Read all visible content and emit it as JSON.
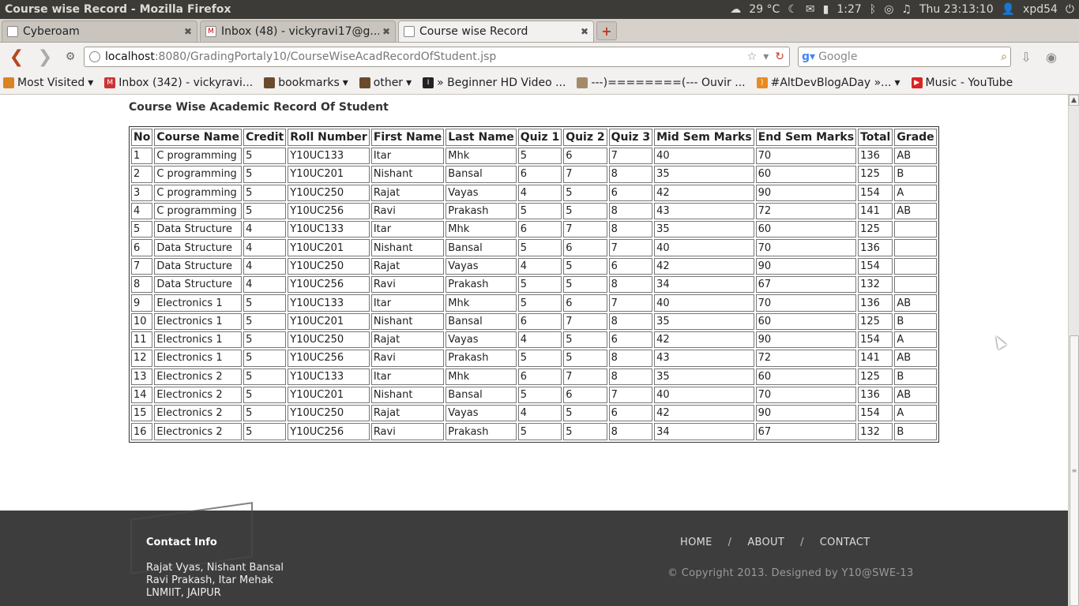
{
  "os": {
    "window_title": "Course wise Record - Mozilla Firefox",
    "temperature": "29 °C",
    "time_small": "1:27",
    "clock": "Thu 23:13:10",
    "user": "xpd54"
  },
  "tabs": [
    {
      "label": "Cyberoam"
    },
    {
      "label": "Inbox (48) - vickyravi17@g..."
    },
    {
      "label": "Course wise Record"
    }
  ],
  "nav": {
    "url_host": "localhost",
    "url_path": ":8080/GradingPortaly10/CourseWiseAcadRecordOfStudent.jsp",
    "search_placeholder": "Google"
  },
  "bookmarks": [
    {
      "label": "Most Visited"
    },
    {
      "label": "Inbox (342) - vickyravi..."
    },
    {
      "label": "bookmarks"
    },
    {
      "label": "other"
    },
    {
      "label": "» Beginner HD Video ..."
    },
    {
      "label": "---)========(--- Ouvir ..."
    },
    {
      "label": "#AltDevBlogADay »..."
    },
    {
      "label": "Music - YouTube"
    }
  ],
  "page": {
    "heading": "Course Wise Academic Record Of Student",
    "columns": [
      "No",
      "Course Name",
      "Credit",
      "Roll Number",
      "First Name",
      "Last Name",
      "Quiz 1",
      "Quiz 2",
      "Quiz 3",
      "Mid Sem Marks",
      "End Sem Marks",
      "Total",
      "Grade"
    ],
    "rows": [
      [
        "1",
        "C programming",
        "5",
        "Y10UC133",
        "Itar",
        "Mhk",
        "5",
        "6",
        "7",
        "40",
        "70",
        "136",
        "AB"
      ],
      [
        "2",
        "C programming",
        "5",
        "Y10UC201",
        "Nishant",
        "Bansal",
        "6",
        "7",
        "8",
        "35",
        "60",
        "125",
        "B"
      ],
      [
        "3",
        "C programming",
        "5",
        "Y10UC250",
        "Rajat",
        "Vayas",
        "4",
        "5",
        "6",
        "42",
        "90",
        "154",
        "A"
      ],
      [
        "4",
        "C programming",
        "5",
        "Y10UC256",
        "Ravi",
        "Prakash",
        "5",
        "5",
        "8",
        "43",
        "72",
        "141",
        "AB"
      ],
      [
        "5",
        "Data Structure",
        "4",
        "Y10UC133",
        "Itar",
        "Mhk",
        "6",
        "7",
        "8",
        "35",
        "60",
        "125",
        ""
      ],
      [
        "6",
        "Data Structure",
        "4",
        "Y10UC201",
        "Nishant",
        "Bansal",
        "5",
        "6",
        "7",
        "40",
        "70",
        "136",
        ""
      ],
      [
        "7",
        "Data Structure",
        "4",
        "Y10UC250",
        "Rajat",
        "Vayas",
        "4",
        "5",
        "6",
        "42",
        "90",
        "154",
        ""
      ],
      [
        "8",
        "Data Structure",
        "4",
        "Y10UC256",
        "Ravi",
        "Prakash",
        "5",
        "5",
        "8",
        "34",
        "67",
        "132",
        ""
      ],
      [
        "9",
        "Electronics 1",
        "5",
        "Y10UC133",
        "Itar",
        "Mhk",
        "5",
        "6",
        "7",
        "40",
        "70",
        "136",
        "AB"
      ],
      [
        "10",
        "Electronics 1",
        "5",
        "Y10UC201",
        "Nishant",
        "Bansal",
        "6",
        "7",
        "8",
        "35",
        "60",
        "125",
        "B"
      ],
      [
        "11",
        "Electronics 1",
        "5",
        "Y10UC250",
        "Rajat",
        "Vayas",
        "4",
        "5",
        "6",
        "42",
        "90",
        "154",
        "A"
      ],
      [
        "12",
        "Electronics 1",
        "5",
        "Y10UC256",
        "Ravi",
        "Prakash",
        "5",
        "5",
        "8",
        "43",
        "72",
        "141",
        "AB"
      ],
      [
        "13",
        "Electronics 2",
        "5",
        "Y10UC133",
        "Itar",
        "Mhk",
        "6",
        "7",
        "8",
        "35",
        "60",
        "125",
        "B"
      ],
      [
        "14",
        "Electronics 2",
        "5",
        "Y10UC201",
        "Nishant",
        "Bansal",
        "5",
        "6",
        "7",
        "40",
        "70",
        "136",
        "AB"
      ],
      [
        "15",
        "Electronics 2",
        "5",
        "Y10UC250",
        "Rajat",
        "Vayas",
        "4",
        "5",
        "6",
        "42",
        "90",
        "154",
        "A"
      ],
      [
        "16",
        "Electronics 2",
        "5",
        "Y10UC256",
        "Ravi",
        "Prakash",
        "5",
        "5",
        "8",
        "34",
        "67",
        "132",
        "B"
      ]
    ]
  },
  "footer": {
    "contact_title": "Contact Info",
    "contact_lines": [
      "Rajat Vyas, Nishant Bansal",
      "Ravi Prakash, Itar Mehak",
      "LNMIIT, JAIPUR"
    ],
    "nav": {
      "home": "HOME",
      "about": "ABOUT",
      "contact": "CONTACT",
      "sep": "/"
    },
    "copyright": "© Copyright 2013. Designed by Y10@SWE-13"
  },
  "colors": {
    "footer_bg": "#3d3d3d",
    "os_bar": "#3c3b37",
    "back_button": "#b5481c"
  }
}
